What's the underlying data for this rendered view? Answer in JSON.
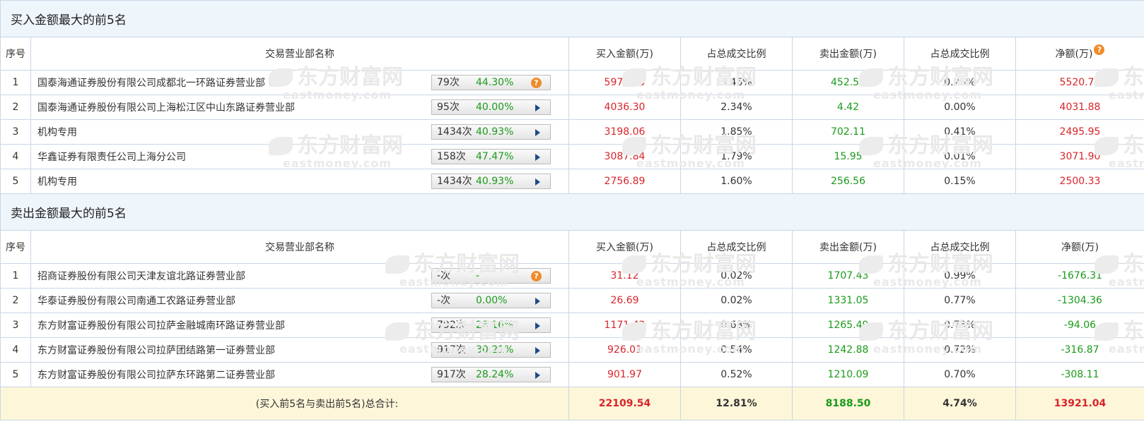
{
  "watermark": {
    "cn": "东方财富网",
    "en": "eastmoney.com"
  },
  "buy_section": {
    "title": "买入金额最大的前5名",
    "headers": [
      "序号",
      "交易营业部名称",
      "买入金额(万)",
      "占总成交比例",
      "卖出金额(万)",
      "占总成交比例",
      "净额(万)"
    ],
    "rows": [
      {
        "idx": "1",
        "name": "国泰海通证券股份有限公司成都北一环路证券营业部",
        "count": "79次",
        "pct": "44.30%",
        "icon": "help-icon",
        "buy": "5973.23",
        "buy_ratio": "3.46%",
        "sell": "452.53",
        "sell_ratio": "0.26%",
        "net": "5520.70"
      },
      {
        "idx": "2",
        "name": "国泰海通证券股份有限公司上海松江区中山东路证券营业部",
        "count": "95次",
        "pct": "40.00%",
        "icon": "arrow-right-icon",
        "buy": "4036.30",
        "buy_ratio": "2.34%",
        "sell": "4.42",
        "sell_ratio": "0.00%",
        "net": "4031.88"
      },
      {
        "idx": "3",
        "name": "机构专用",
        "count": "1434次",
        "pct": "40.93%",
        "icon": "arrow-right-icon",
        "buy": "3198.06",
        "buy_ratio": "1.85%",
        "sell": "702.11",
        "sell_ratio": "0.41%",
        "net": "2495.95"
      },
      {
        "idx": "4",
        "name": "华鑫证券有限责任公司上海分公司",
        "count": "158次",
        "pct": "47.47%",
        "icon": "arrow-right-icon",
        "buy": "3087.84",
        "buy_ratio": "1.79%",
        "sell": "15.95",
        "sell_ratio": "0.01%",
        "net": "3071.90"
      },
      {
        "idx": "5",
        "name": "机构专用",
        "count": "1434次",
        "pct": "40.93%",
        "icon": "arrow-right-icon",
        "buy": "2756.89",
        "buy_ratio": "1.60%",
        "sell": "256.56",
        "sell_ratio": "0.15%",
        "net": "2500.33"
      }
    ]
  },
  "sell_section": {
    "title": "卖出金额最大的前5名",
    "headers": [
      "序号",
      "交易营业部名称",
      "买入金额(万)",
      "占总成交比例",
      "卖出金额(万)",
      "占总成交比例",
      "净额(万)"
    ],
    "rows": [
      {
        "idx": "1",
        "name": "招商证券股份有限公司天津友谊北路证券营业部",
        "count": "-次",
        "pct": "-",
        "icon": "help-icon",
        "buy": "31.12",
        "buy_ratio": "0.02%",
        "sell": "1707.43",
        "sell_ratio": "0.99%",
        "net": "-1676.31"
      },
      {
        "idx": "2",
        "name": "华泰证券股份有限公司南通工农路证券营业部",
        "count": "-次",
        "pct": "0.00%",
        "icon": "arrow-right-icon",
        "buy": "26.69",
        "buy_ratio": "0.02%",
        "sell": "1331.05",
        "sell_ratio": "0.77%",
        "net": "-1304.36"
      },
      {
        "idx": "3",
        "name": "东方财富证券股份有限公司拉萨金融城南环路证券营业部",
        "count": "792次",
        "pct": "28.16%",
        "icon": "arrow-right-icon",
        "buy": "1171.42",
        "buy_ratio": "0.68%",
        "sell": "1265.49",
        "sell_ratio": "0.73%",
        "net": "-94.06"
      },
      {
        "idx": "4",
        "name": "东方财富证券股份有限公司拉萨团结路第一证券营业部",
        "count": "917次",
        "pct": "30.21%",
        "icon": "arrow-right-icon",
        "buy": "926.01",
        "buy_ratio": "0.54%",
        "sell": "1242.88",
        "sell_ratio": "0.72%",
        "net": "-316.87"
      },
      {
        "idx": "5",
        "name": "东方财富证券股份有限公司拉萨东环路第二证券营业部",
        "count": "917次",
        "pct": "28.24%",
        "icon": "arrow-right-icon",
        "buy": "901.97",
        "buy_ratio": "0.52%",
        "sell": "1210.09",
        "sell_ratio": "0.70%",
        "net": "-308.11"
      }
    ]
  },
  "total": {
    "label": "(买入前5名与卖出前5名)总合计:",
    "buy": "22109.54",
    "buy_ratio": "12.81%",
    "sell": "8188.50",
    "sell_ratio": "4.74%",
    "net": "13921.04"
  },
  "colors": {
    "red": "#d9242a",
    "green": "#1a9a1a",
    "title_bg": "#eef5fb",
    "total_bg": "#fdf6d9",
    "border": "#c9d6e6"
  }
}
